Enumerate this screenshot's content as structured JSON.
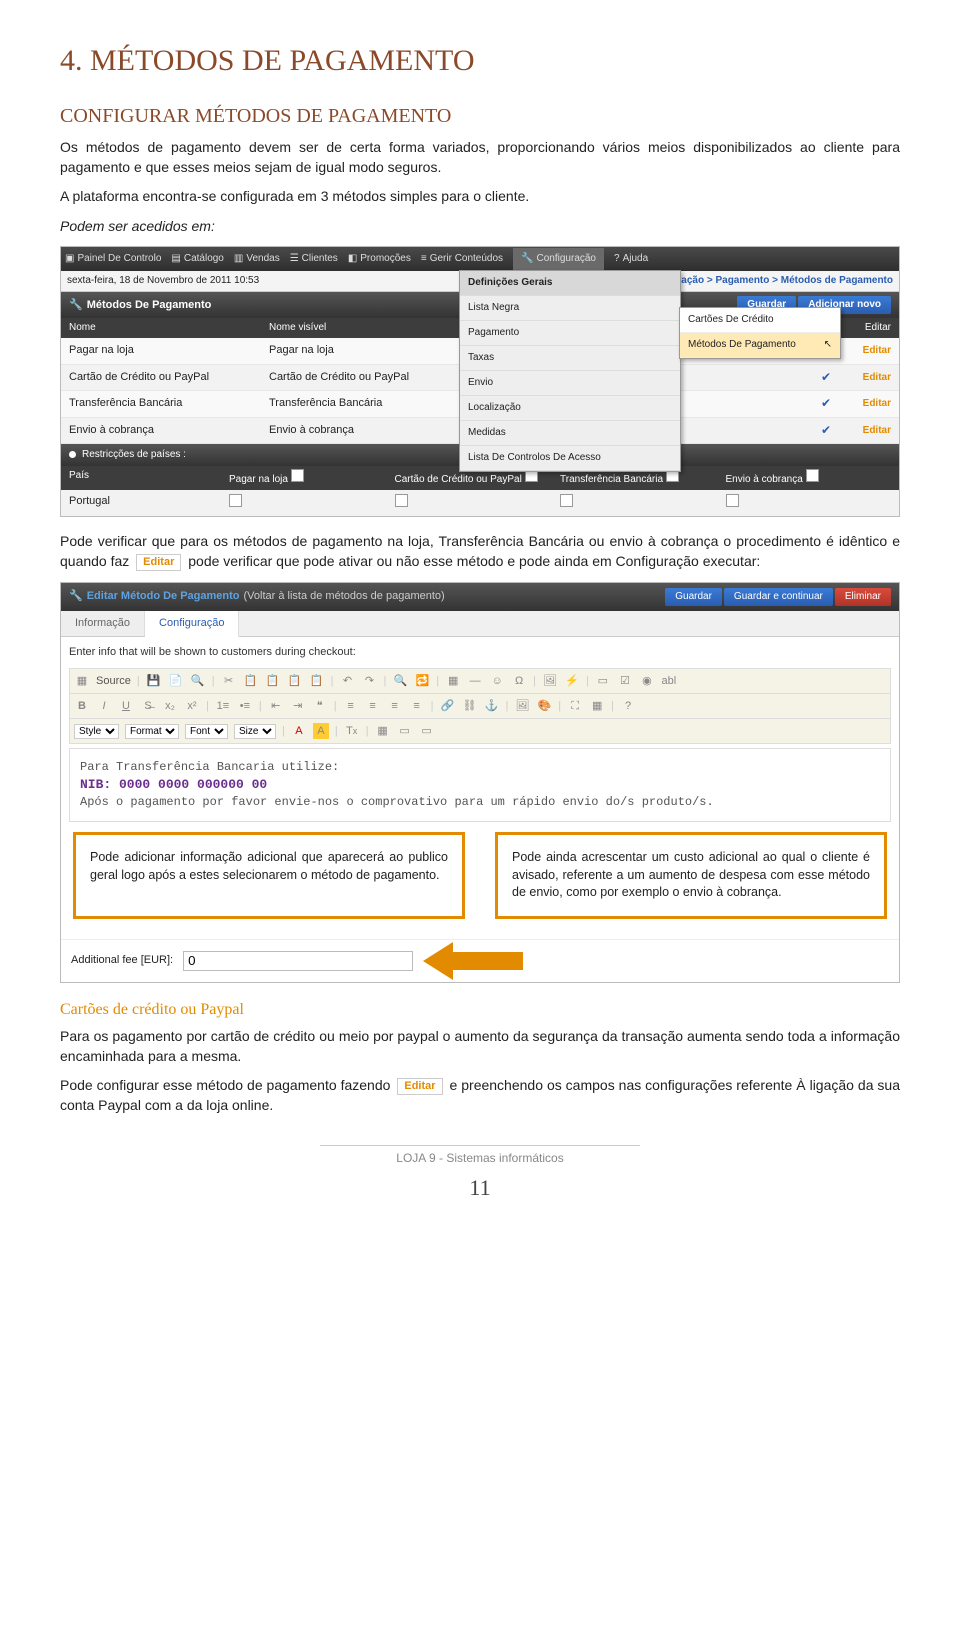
{
  "heading": "4. MÉTODOS DE PAGAMENTO",
  "subheading": "CONFIGURAR MÉTODOS DE PAGAMENTO",
  "intro1": "Os métodos de pagamento devem ser de certa forma variados, proporcionando vários meios disponibilizados ao cliente para pagamento e que esses meios sejam de igual modo seguros.",
  "intro2": "A plataforma encontra-se configurada em 3 métodos simples para o cliente.",
  "intro3": "Podem ser acedidos em:",
  "topnav": {
    "items": [
      "Painel De Controlo",
      "Catálogo",
      "Vendas",
      "Clientes",
      "Promoções",
      "Gerir Conteúdos",
      "Configuração",
      "Ajuda"
    ]
  },
  "datetime": "sexta-feira, 18 de Novembro de 2011 10:53",
  "breadcrumb": "Início > Configuração > Pagamento > Métodos de Pagamento",
  "section_title": "Métodos De Pagamento",
  "buttons": {
    "save": "Guardar",
    "addnew": "Adicionar novo",
    "savecont": "Guardar e continuar",
    "delete": "Eliminar"
  },
  "columns": {
    "name": "Nome",
    "visible": "Nome visível",
    "edit": "Editar"
  },
  "rows": [
    {
      "name": "Pagar na loja",
      "visible": "Pagar na loja",
      "check": true
    },
    {
      "name": "Cartão de Crédito ou PayPal",
      "visible": "Cartão de Crédito ou PayPal",
      "check": true
    },
    {
      "name": "Transferência Bancária",
      "visible": "Transferência Bancária",
      "check": true
    },
    {
      "name": "Envio à cobrança",
      "visible": "Envio à cobrança",
      "check": true
    }
  ],
  "dropdown": [
    "Definições Gerais",
    "Lista Negra",
    "Pagamento",
    "Taxas",
    "Envio",
    "Localização",
    "Medidas",
    "Lista De Controlos De Acesso"
  ],
  "submenu": [
    "Cartões De Crédito",
    "Métodos De Pagamento"
  ],
  "restrict_label": "Restricções de países :",
  "country_cols": [
    "País",
    "Pagar na loja",
    "Cartão de Crédito ou PayPal",
    "Transferência Bancária",
    "Envio à cobrança"
  ],
  "country_row": "Portugal",
  "mid_para_a": "Pode verificar que para os métodos de pagamento na loja, Transferência Bancária ou envio à cobrança o procedimento é idêntico e quando faz ",
  "mid_para_b": " pode verificar que pode ativar ou não esse método e pode ainda em Configuração executar:",
  "editar_label": "Editar",
  "shot2": {
    "title": "Editar Método De Pagamento",
    "sub": "(Voltar à lista de métodos de pagamento)",
    "tabs": [
      "Informação",
      "Configuração"
    ],
    "hint": "Enter info that will be shown to customers during checkout:",
    "toolbar_source": "Source",
    "style": "Style",
    "format": "Format",
    "font": "Font",
    "size": "Size",
    "body_line1": "Para Transferência Bancaria utilize:",
    "body_nib": "NIB: 0000 0000 000000 00",
    "body_line2": "Após o pagamento por favor envie-nos o comprovativo para um rápido envio do/s produto/s.",
    "fee_label": "Additional fee [EUR]:",
    "fee_value": "0"
  },
  "callout1": "Pode adicionar informação adicional que aparecerá ao publico geral logo após a estes selecionarem o método de pagamento.",
  "callout2": "Pode ainda acrescentar um custo adicional ao qual o cliente é avisado, referente a um aumento de despesa com esse método de envio, como por exemplo o envio à cobrança.",
  "cc_heading": "Cartões de crédito ou Paypal",
  "cc_para1": "Para os pagamento por cartão de crédito ou meio por paypal o aumento da segurança da transação aumenta sendo toda a informação encaminhada para a mesma.",
  "cc_para2a": "Pode configurar esse método de pagamento fazendo ",
  "cc_para2b": " e preenchendo os campos nas configurações referente À ligação da sua conta Paypal com a da loja online.",
  "footer": "LOJA 9 - Sistemas informáticos",
  "page": "11"
}
